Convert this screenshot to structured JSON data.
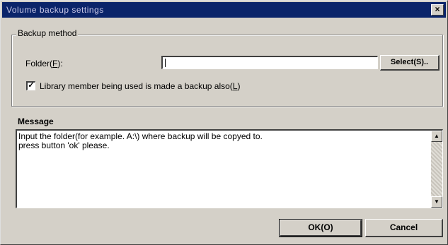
{
  "window": {
    "title": "Volume backup settings"
  },
  "close_icon": "close-icon",
  "backup_group": {
    "legend": "Backup method",
    "folder_label": "Folder(",
    "folder_hotkey": "F",
    "folder_label_end": "):",
    "folder_value": "",
    "select_label": "Select(S)..",
    "checkbox_checked": true,
    "checkbox_label": "Library member being used is made a backup also(",
    "checkbox_hotkey": "L",
    "checkbox_label_end": ")"
  },
  "message": {
    "label": "Message",
    "text": "Input the folder(for example. A:\\) where backup will be copyed to.\npress button 'ok' please."
  },
  "buttons": {
    "ok_label": "OK(O)",
    "cancel_label": "Cancel"
  }
}
